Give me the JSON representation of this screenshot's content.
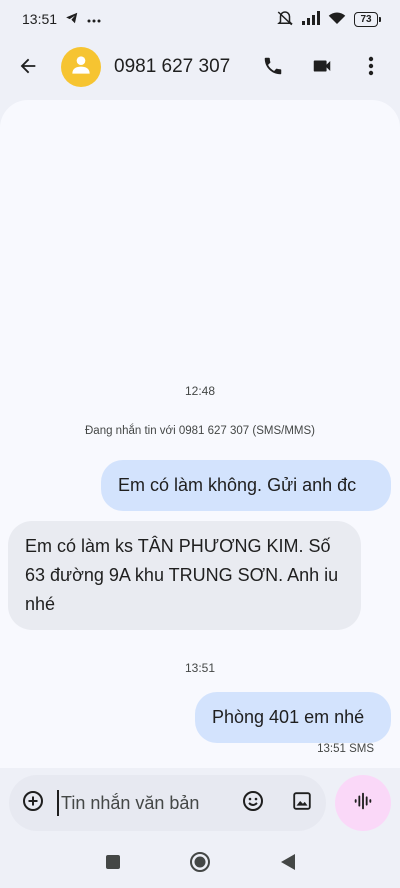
{
  "status_bar": {
    "time": "13:51",
    "left_icons": [
      "telegram-icon",
      "more-dots-icon"
    ],
    "right_icons": [
      "mute-icon",
      "signal-icon",
      "wifi-icon"
    ],
    "battery": "73"
  },
  "header": {
    "contact": "0981 627 307",
    "avatar_color": "#f6c431",
    "icons": [
      "back-arrow-icon",
      "phone-icon",
      "video-call-icon",
      "more-vert-icon"
    ]
  },
  "conversation": {
    "time_1": "12:48",
    "info": "Đang nhắn tin với 0981 627 307 (SMS/MMS)",
    "messages": [
      {
        "direction": "outgoing",
        "text": "Em có làm không. Gửi anh đc"
      },
      {
        "direction": "incoming",
        "text": "Em có làm ks TÂN PHƯƠNG KIM. Số 63 đường 9A khu TRUNG SƠN. Anh iu nhé"
      }
    ],
    "time_2": "13:51",
    "last_message": {
      "direction": "outgoing",
      "text": "Phòng 401 em nhé",
      "meta": "13:51 SMS"
    }
  },
  "compose": {
    "placeholder": "Tin nhắn văn bản",
    "icons": [
      "add-circle-icon",
      "emoji-icon",
      "gallery-icon",
      "voice-waveform-icon"
    ]
  },
  "nav": [
    "recents-square-icon",
    "home-circle-icon",
    "back-triangle-icon"
  ],
  "colors": {
    "outgoing_bubble": "#d3e3fd",
    "incoming_bubble": "#e9ebf1",
    "voice_button": "#fad8f8",
    "background": "#eef0f7"
  }
}
